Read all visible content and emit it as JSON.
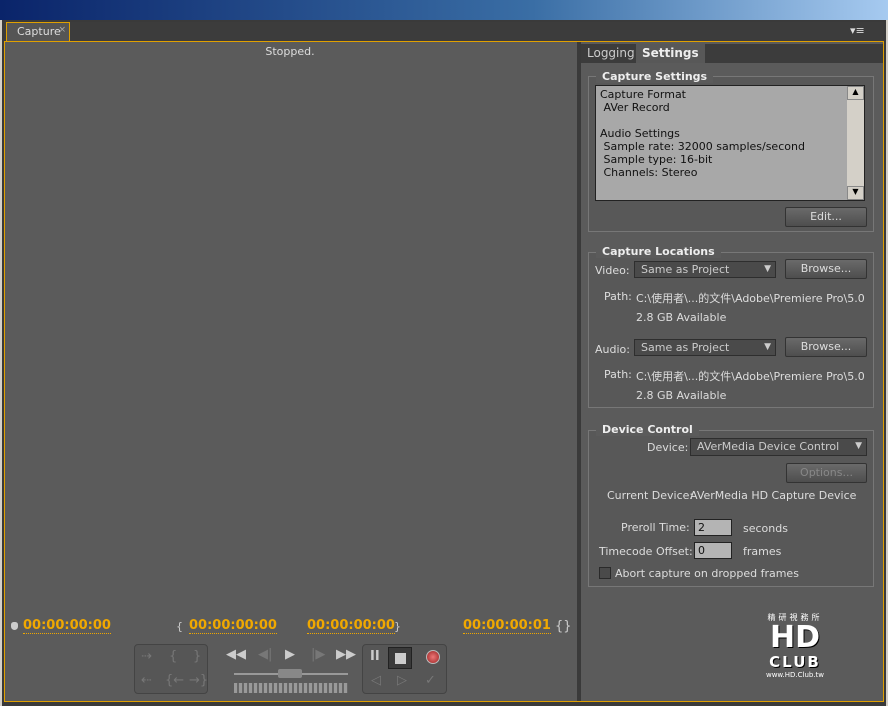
{
  "window": {
    "tab_label": "Capture",
    "close_glyph": "×",
    "menu_glyph": "▾≡"
  },
  "monitor": {
    "status": "Stopped.",
    "timecodes": {
      "current": "00:00:00:00",
      "in": "00:00:00:00",
      "out": "00:00:00:00",
      "duration": "00:00:00:01"
    }
  },
  "tabs": {
    "logging": "Logging",
    "settings": "Settings"
  },
  "capture_settings": {
    "title": "Capture Settings",
    "text": "Capture Format\n AVer Record\n\nAudio Settings\n Sample rate: 32000 samples/second\n Sample type: 16-bit\n Channels: Stereo",
    "edit": "Edit..."
  },
  "capture_locations": {
    "title": "Capture Locations",
    "video_label": "Video:",
    "video_value": "Same as Project",
    "audio_label": "Audio:",
    "audio_value": "Same as Project",
    "browse": "Browse...",
    "path_label": "Path:",
    "video_path": "C:\\使用者\\...的文件\\Adobe\\Premiere Pro\\5.0",
    "video_available": "2.8 GB Available",
    "audio_path": "C:\\使用者\\...的文件\\Adobe\\Premiere Pro\\5.0",
    "audio_available": "2.8 GB Available"
  },
  "device_control": {
    "title": "Device Control",
    "device_label": "Device:",
    "device_value": "AVerMedia Device Control",
    "options": "Options...",
    "current_device_label": "Current Device:",
    "current_device": "AVerMedia HD Capture Device",
    "preroll_label": "Preroll Time:",
    "preroll_value": "2",
    "preroll_unit": "seconds",
    "offset_label": "Timecode Offset:",
    "offset_value": "0",
    "offset_unit": "frames",
    "abort_label": "Abort capture on dropped frames",
    "abort_checked": false
  },
  "watermark": {
    "text": "HD CLUB",
    "sub": "www.HD.Club.tw",
    "top": "精研視務所"
  }
}
